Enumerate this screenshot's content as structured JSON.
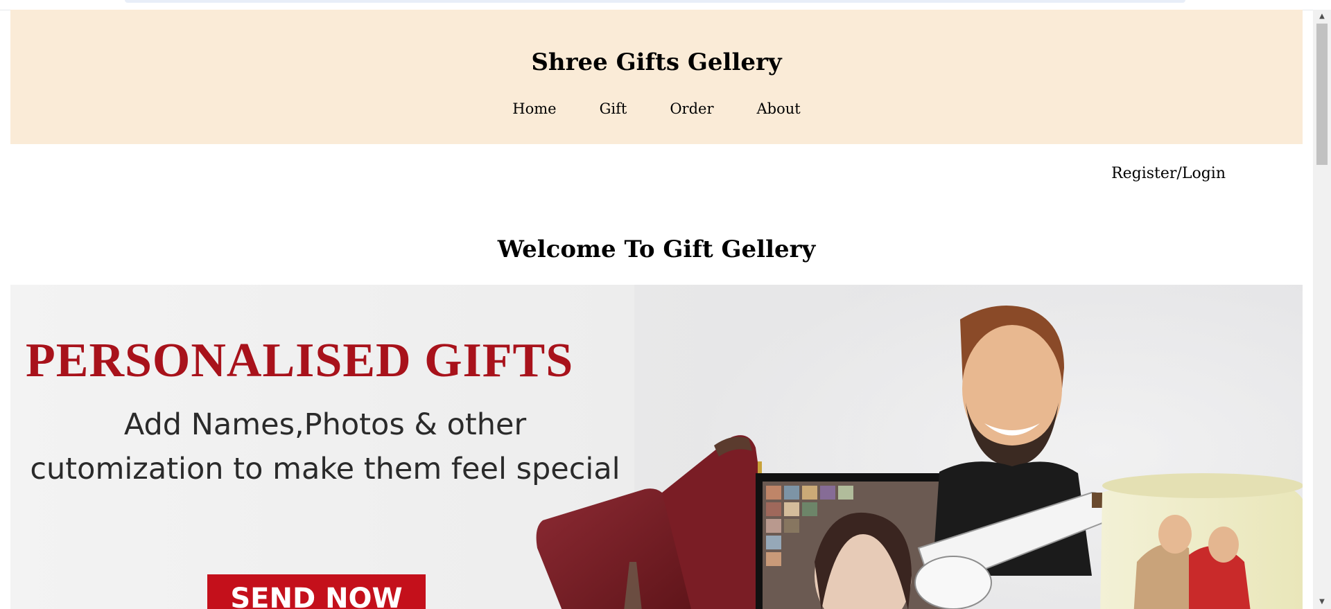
{
  "header": {
    "site_title": "Shree Gifts Gellery",
    "nav": [
      "Home",
      "Gift",
      "Order",
      "About"
    ],
    "background": "#faebd7"
  },
  "auth": {
    "register_login": "Register/Login"
  },
  "main": {
    "welcome": "Welcome To Gift Gellery"
  },
  "banner": {
    "headline": "PERSONALISED GIFTS",
    "sub_line1": "Add Names,Photos & other",
    "sub_line2": "cutomization to make them feel special",
    "cta": "SEND NOW",
    "headline_color": "#a8121b",
    "cta_color": "#c4101b"
  },
  "scrollbar": {
    "up_icon": "chevron-up-icon",
    "down_icon": "chevron-down-icon"
  }
}
